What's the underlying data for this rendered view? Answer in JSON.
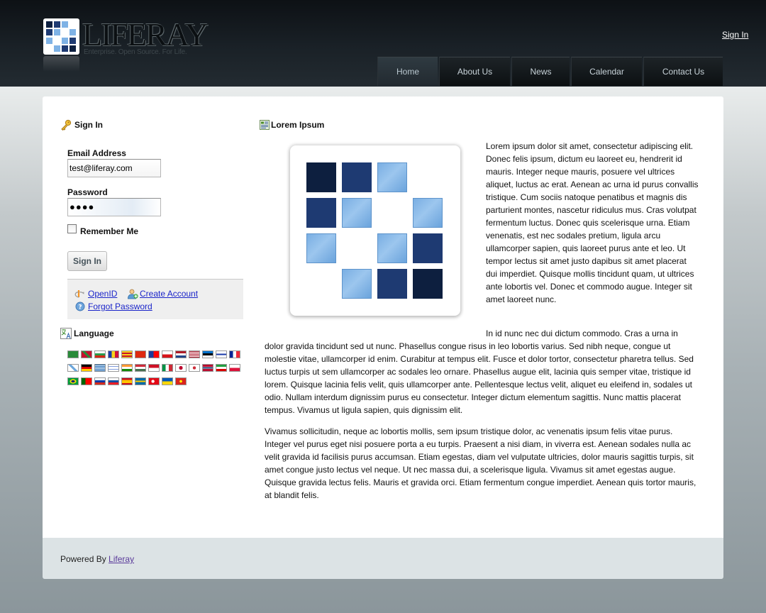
{
  "header": {
    "logo_text": "LIFERAY",
    "logo_tagline": "Enterprise. Open Source. For Life.",
    "sign_in_link": "Sign In",
    "nav": [
      {
        "label": "Home",
        "active": true
      },
      {
        "label": "About Us",
        "active": false
      },
      {
        "label": "News",
        "active": false
      },
      {
        "label": "Calendar",
        "active": false
      },
      {
        "label": "Contact Us",
        "active": false
      }
    ]
  },
  "signin_portlet": {
    "title": "Sign In",
    "email_label": "Email Address",
    "email_value": "test@liferay.com",
    "password_label": "Password",
    "password_value": "●●●●",
    "remember_me_label": "Remember Me",
    "remember_me_checked": false,
    "submit_label": "Sign In",
    "links": {
      "openid": "OpenID",
      "create_account": "Create Account",
      "forgot_password": "Forgot Password"
    }
  },
  "language_portlet": {
    "title": "Language",
    "flags": [
      "ar_SA",
      "eu_ES",
      "bg_BG",
      "ca_AD",
      "ca_ES",
      "zh_CN",
      "zh_TW",
      "cs_CZ",
      "nl_NL",
      "en_US",
      "et_EE",
      "fi_FI",
      "fr_FR",
      "gl_ES",
      "de_DE",
      "el_GR",
      "iw_IL",
      "hi_IN",
      "hu_HU",
      "in_ID",
      "it_IT",
      "ja_JP",
      "ko_KR",
      "nb_NO",
      "fa_IR",
      "pl_PL",
      "pt_BR",
      "pt_PT",
      "ru_RU",
      "sk_SK",
      "es_ES",
      "sv_SE",
      "tr_TR",
      "uk_UA",
      "vi_VN"
    ]
  },
  "content_portlet": {
    "title": "Lorem Ipsum",
    "paragraph_1": "Lorem ipsum dolor sit amet, consectetur adipiscing elit. Donec felis ipsum, dictum eu laoreet eu, hendrerit id mauris. Integer neque mauris, posuere vel ultrices aliquet, luctus ac erat. Aenean ac urna id purus convallis tristique. Cum sociis natoque penatibus et magnis dis parturient montes, nascetur ridiculus mus. Cras volutpat fermentum luctus. Donec quis scelerisque urna. Etiam venenatis, est nec sodales pretium, ligula arcu ullamcorper sapien, quis laoreet purus ante et leo. Ut tempor lectus sit amet justo dapibus sit amet placerat dui imperdiet. Quisque mollis tincidunt quam, ut ultrices ante lobortis vel. Donec et commodo augue. Integer sit amet laoreet nunc.",
    "paragraph_2_lead": "In id nunc nec dui dictum commodo. Cras a urna in",
    "paragraph_2": "dolor gravida tincidunt sed ut nunc. Phasellus congue risus in leo lobortis varius. Sed nibh neque, congue ut molestie vitae, ullamcorper id enim. Curabitur at tempus elit. Fusce et dolor tortor, consectetur pharetra tellus. Sed luctus turpis ut sem ullamcorper ac sodales leo ornare. Phasellus augue elit, lacinia quis semper vitae, tristique id lorem. Quisque lacinia felis velit, quis ullamcorper ante. Pellentesque lectus velit, aliquet eu eleifend in, sodales ut odio. Nullam interdum dignissim purus eu consectetur. Integer dictum elementum sagittis. Nunc mattis placerat tempus. Vivamus ut ligula sapien, quis dignissim elit.",
    "paragraph_3": "Vivamus sollicitudin, neque ac lobortis mollis, sem ipsum tristique dolor, ac venenatis ipsum felis vitae purus. Integer vel purus eget nisi posuere porta a eu turpis. Praesent a nisi diam, in viverra est. Aenean sodales nulla ac velit gravida id facilisis purus accumsan. Etiam egestas, diam vel vulputate ultricies, dolor mauris sagittis turpis, sit amet congue justo lectus vel neque. Ut nec massa dui, a scelerisque ligula. Vivamus sit amet egestas augue. Quisque gravida lectus felis. Mauris et gravida orci. Etiam fermentum congue imperdiet. Aenean quis tortor mauris, at blandit felis."
  },
  "footer": {
    "powered_by": "Powered By",
    "powered_link": "Liferay"
  }
}
